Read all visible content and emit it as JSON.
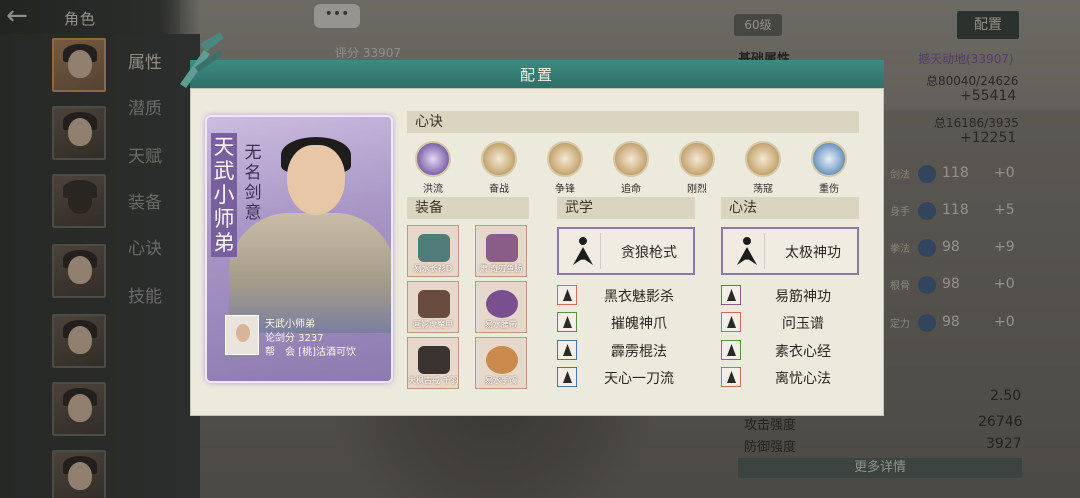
{
  "topbar": {
    "back_icon": "back-arrow-icon",
    "title": "角色"
  },
  "sidebar": {
    "items": [
      {
        "label": "属性",
        "active": true
      },
      {
        "label": "潜质",
        "active": false
      },
      {
        "label": "天赋",
        "active": false
      },
      {
        "label": "装备",
        "active": false
      },
      {
        "label": "心诀",
        "active": false
      },
      {
        "label": "技能",
        "active": false
      }
    ]
  },
  "scene": {
    "chat_icon": "•••",
    "score": "评分 33907"
  },
  "stat_panel": {
    "level": "60级",
    "config_button": "配置",
    "basic_label": "基础属性",
    "rank": "撼天动地(33907)",
    "total1": "总80040/24626",
    "val1": "+55414",
    "total2": "总16186/3935",
    "val2": "+12251",
    "rows": [
      {
        "label": "剑法",
        "value": "118",
        "bonus": "+0"
      },
      {
        "label": "身手",
        "value": "118",
        "bonus": "+5"
      },
      {
        "label": "拳法",
        "value": "98",
        "bonus": "+9"
      },
      {
        "label": "根骨",
        "value": "98",
        "bonus": "+0"
      },
      {
        "label": "定力",
        "value": "98",
        "bonus": "+0"
      }
    ],
    "num_a": "2.50",
    "attack_label": "攻击强度",
    "attack_value": "26746",
    "defense_label": "防御强度",
    "defense_value": "3927",
    "more_button": "更多详情"
  },
  "dialog": {
    "title": "配置",
    "card": {
      "name_vertical": "天武小师弟",
      "title_vertical": "无名剑意",
      "player_name": "天武小师弟",
      "sword_score": "论剑分 3237",
      "guild": "帮　会 [桃]沽酒可饮"
    },
    "xinjue": {
      "header": "心诀",
      "skills": [
        {
          "label": "洪流",
          "style": "purple"
        },
        {
          "label": "奋战",
          "style": "gold"
        },
        {
          "label": "争锋",
          "style": "gold"
        },
        {
          "label": "追命",
          "style": "gold"
        },
        {
          "label": "刚烈",
          "style": "gold"
        },
        {
          "label": "荡寇",
          "style": "gold"
        },
        {
          "label": "重伤",
          "style": "blue"
        }
      ]
    },
    "equipment": {
      "header": "装备",
      "items": [
        {
          "label": "易水长衫D",
          "color": "#4f7b78"
        },
        {
          "label": "肃·奇刃鱼肠",
          "color": "#8a5d86"
        },
        {
          "label": "画影虎魔甲",
          "color": "#6a4c3e"
        },
        {
          "label": "易水腰带",
          "color": "#7a4f8f"
        },
        {
          "label": "天枫古戒·千羽",
          "color": "#3a3430"
        },
        {
          "label": "易水手镯",
          "color": "#c98a4c"
        }
      ]
    },
    "wuxue": {
      "header": "武学",
      "main": "贪狼枪式",
      "list": [
        "黑衣魅影杀",
        "摧魄神爪",
        "霹雳棍法",
        "天心一刀流"
      ]
    },
    "xinfa": {
      "header": "心法",
      "main": "太极神功",
      "list": [
        "易筋神功",
        "问玉谱",
        "素衣心经",
        "离忧心法"
      ]
    }
  }
}
